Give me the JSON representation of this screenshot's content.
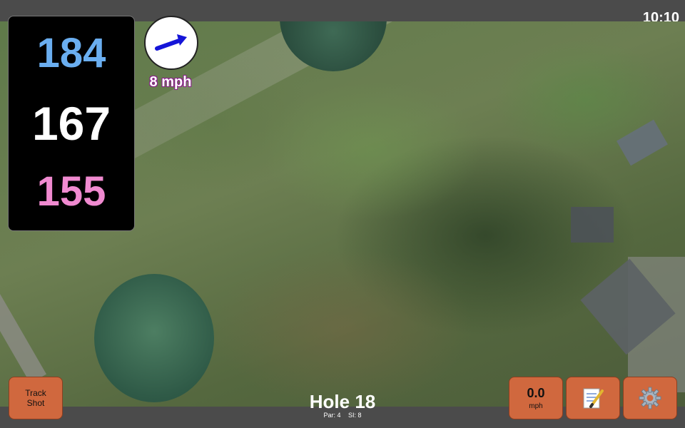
{
  "clock": "10:10",
  "distances": {
    "back": "184",
    "middle": "167",
    "front": "155"
  },
  "wind": {
    "speed": "8 mph",
    "direction_icon": "arrow-right-up-icon"
  },
  "buttons": {
    "track_shot_line1": "Track",
    "track_shot_line2": "Shot",
    "speed_value": "0.0",
    "speed_unit": "mph",
    "notes_icon": "notepad-icon",
    "settings_icon": "gear-icon"
  },
  "hole": {
    "title": "Hole 18",
    "par": "Par: 4",
    "si": "SI: 8"
  },
  "colors": {
    "back": "#6aaef0",
    "middle": "#ffffff",
    "front": "#f08ad0",
    "button": "#d0683e"
  }
}
